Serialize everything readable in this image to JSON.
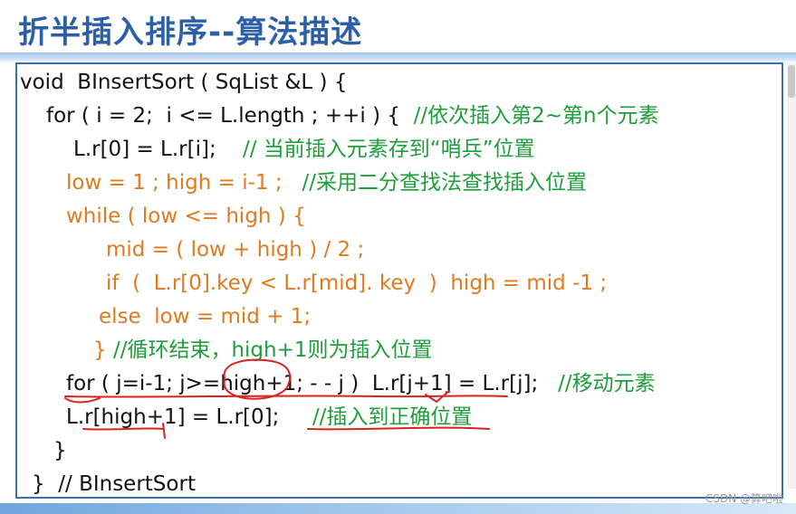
{
  "slide": {
    "title": "折半插入排序--算法描述"
  },
  "code": {
    "l1": "void  BInsertSort ( SqList &L ) {",
    "l2_code": "for ( i = 2;  i <= L.length ; ++i ) {  ",
    "l2_comment": "//依次插入第2~第n个元素",
    "l3_code": "L.r[0] = L.r[i];    ",
    "l3_comment": "// 当前插入元素存到“哨兵”位置",
    "l4_code": "low = 1 ; high = i-1 ;   ",
    "l4_comment": "//采用二分查找法查找插入位置",
    "l5_code": "while ( low <= high ) {",
    "l6_code": "mid = ( low + high ) / 2 ;",
    "l7_code": "if  (  L.r[0].key < L.r[mid]. key  )  high = mid -1 ;",
    "l8_code": "else  low = mid + 1;",
    "l9_brace": "} ",
    "l9_comment": "//循环结束，high+1则为插入位置",
    "l10_code": "for ( j=i-1; j>=high+1; - - j )  L.r[j+1] = L.r[j];   ",
    "l10_comment": "//移动元素",
    "l11_code": "L.r[high+1] = L.r[0];     ",
    "l11_comment": "//插入到正确位置",
    "l12": "}",
    "l13": "}  // BInsertSort"
  },
  "footer": {
    "watermark": "CSDN @算吧啦"
  },
  "colors": {
    "title": "#2b5fa8",
    "keyword_orange": "#e07a1f",
    "comment_green": "#1d9e3a",
    "annotation_red": "#d8231f",
    "border_blue": "#3b6fb3"
  }
}
